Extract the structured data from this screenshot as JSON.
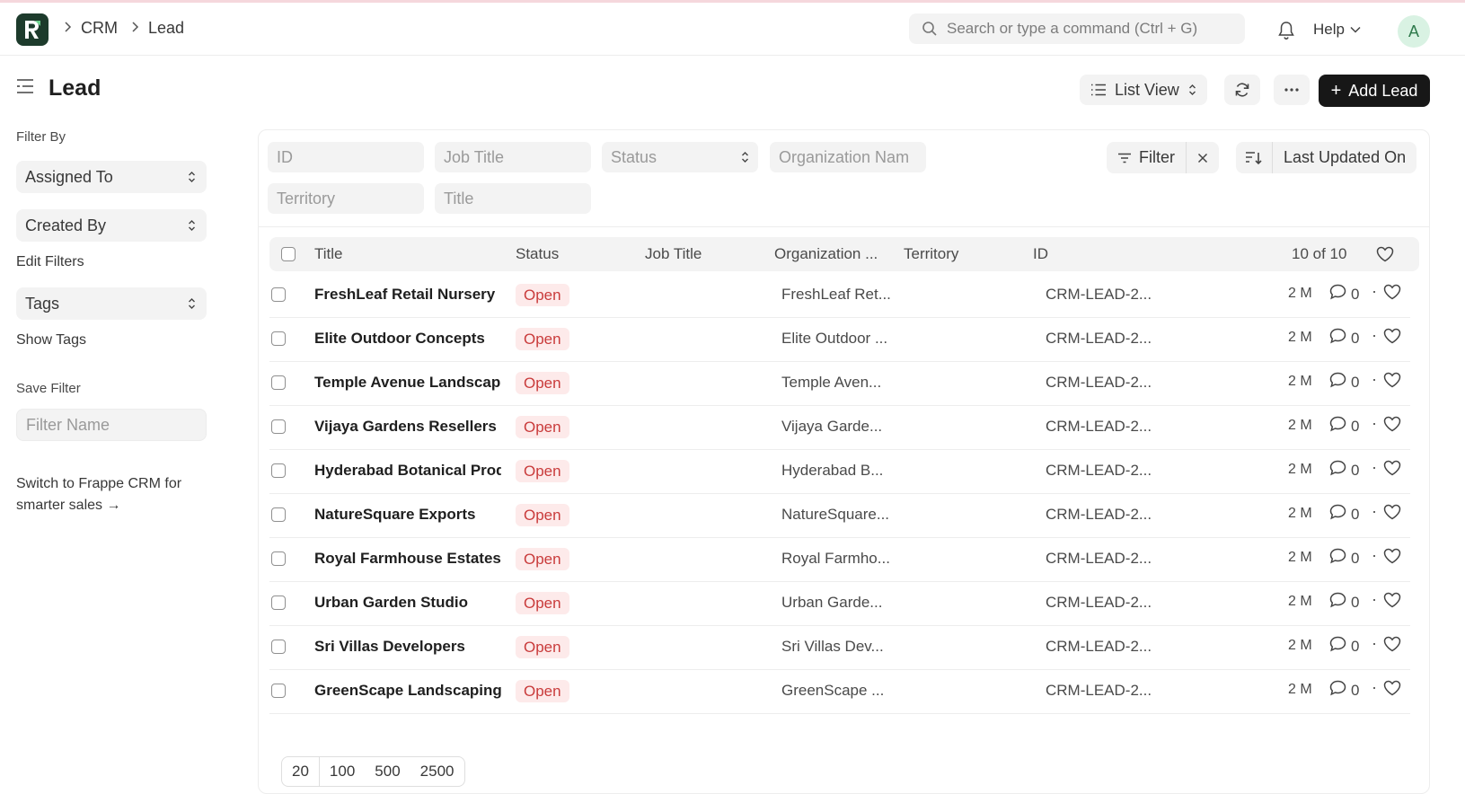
{
  "breadcrumb": [
    "CRM",
    "Lead"
  ],
  "search": {
    "placeholder": "Search or type a command (Ctrl + G)"
  },
  "help_label": "Help",
  "avatar_initial": "A",
  "page": {
    "title": "Lead",
    "view_label": "List View",
    "add_label": "Add Lead"
  },
  "sidebar": {
    "filter_by_label": "Filter By",
    "assigned_to": "Assigned To",
    "created_by": "Created By",
    "edit_filters": "Edit Filters",
    "tags": "Tags",
    "show_tags": "Show Tags",
    "save_filter_label": "Save Filter",
    "filter_name_placeholder": "Filter Name",
    "cta_line1": "Switch to Frappe CRM for",
    "cta_line2": "smarter sales →"
  },
  "filters": {
    "id": "ID",
    "job_title": "Job Title",
    "status": "Status",
    "organization": "Organization Nam",
    "territory": "Territory",
    "title": "Title",
    "filter_button": "Filter",
    "sort_label": "Last Updated On"
  },
  "table": {
    "columns": [
      "Title",
      "Status",
      "Job Title",
      "Organization ...",
      "Territory",
      "ID"
    ],
    "count": "10 of 10",
    "rows": [
      {
        "title": "FreshLeaf Retail Nursery",
        "status": "Open",
        "org": "FreshLeaf Ret...",
        "id": "CRM-LEAD-2...",
        "time": "2 M",
        "comments": "0"
      },
      {
        "title": "Elite Outdoor Concepts",
        "status": "Open",
        "org": "Elite Outdoor ...",
        "id": "CRM-LEAD-2...",
        "time": "2 M",
        "comments": "0"
      },
      {
        "title": "Temple Avenue Landscape",
        "status": "Open",
        "org": "Temple Aven...",
        "id": "CRM-LEAD-2...",
        "time": "2 M",
        "comments": "0"
      },
      {
        "title": "Vijaya Gardens Resellers",
        "status": "Open",
        "org": "Vijaya Garde...",
        "id": "CRM-LEAD-2...",
        "time": "2 M",
        "comments": "0"
      },
      {
        "title": "Hyderabad Botanical Products",
        "status": "Open",
        "org": "Hyderabad B...",
        "id": "CRM-LEAD-2...",
        "time": "2 M",
        "comments": "0"
      },
      {
        "title": "NatureSquare Exports",
        "status": "Open",
        "org": "NatureSquare...",
        "id": "CRM-LEAD-2...",
        "time": "2 M",
        "comments": "0"
      },
      {
        "title": "Royal Farmhouse Estates",
        "status": "Open",
        "org": "Royal Farmho...",
        "id": "CRM-LEAD-2...",
        "time": "2 M",
        "comments": "0"
      },
      {
        "title": "Urban Garden Studio",
        "status": "Open",
        "org": "Urban Garde...",
        "id": "CRM-LEAD-2...",
        "time": "2 M",
        "comments": "0"
      },
      {
        "title": "Sri Villas Developers",
        "status": "Open",
        "org": "Sri Villas Dev...",
        "id": "CRM-LEAD-2...",
        "time": "2 M",
        "comments": "0"
      },
      {
        "title": "GreenScape Landscaping",
        "status": "Open",
        "org": "GreenScape ...",
        "id": "CRM-LEAD-2...",
        "time": "2 M",
        "comments": "0"
      }
    ]
  },
  "pager": [
    "20",
    "100",
    "500",
    "2500"
  ]
}
